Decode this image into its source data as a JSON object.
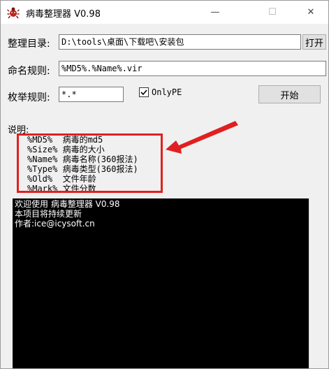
{
  "window": {
    "title": "病毒整理器 V0.98",
    "min_glyph": "—",
    "max_glyph": "☐",
    "close_glyph": "✕"
  },
  "form": {
    "dir_label": "整理目录:",
    "dir_value": "D:\\tools\\桌面\\下载吧\\安装包",
    "open_button": "打开",
    "naming_label": "命名规则:",
    "naming_value": "%MD5%.%Name%.vir",
    "enum_label": "枚举规则:",
    "enum_value": "*.*",
    "onlype_label": "OnlyPE",
    "onlype_checked": true,
    "start_button": "开始"
  },
  "help": {
    "heading": "说明:",
    "lines": [
      "%MD5%  病毒的md5",
      "%Size% 病毒的大小",
      "%Name% 病毒名称(360报法)",
      "%Type% 病毒类型(360报法)",
      "%Old%  文件年龄",
      "%Mark% 文件分数"
    ]
  },
  "console": {
    "lines": [
      "欢迎使用 病毒整理器 V0.98",
      "本项目将持续更新",
      "作者:ice@icysoft.cn"
    ]
  },
  "colors": {
    "annotation_red": "#e02020",
    "console_bg": "#000000",
    "console_fg": "#ffffff"
  }
}
